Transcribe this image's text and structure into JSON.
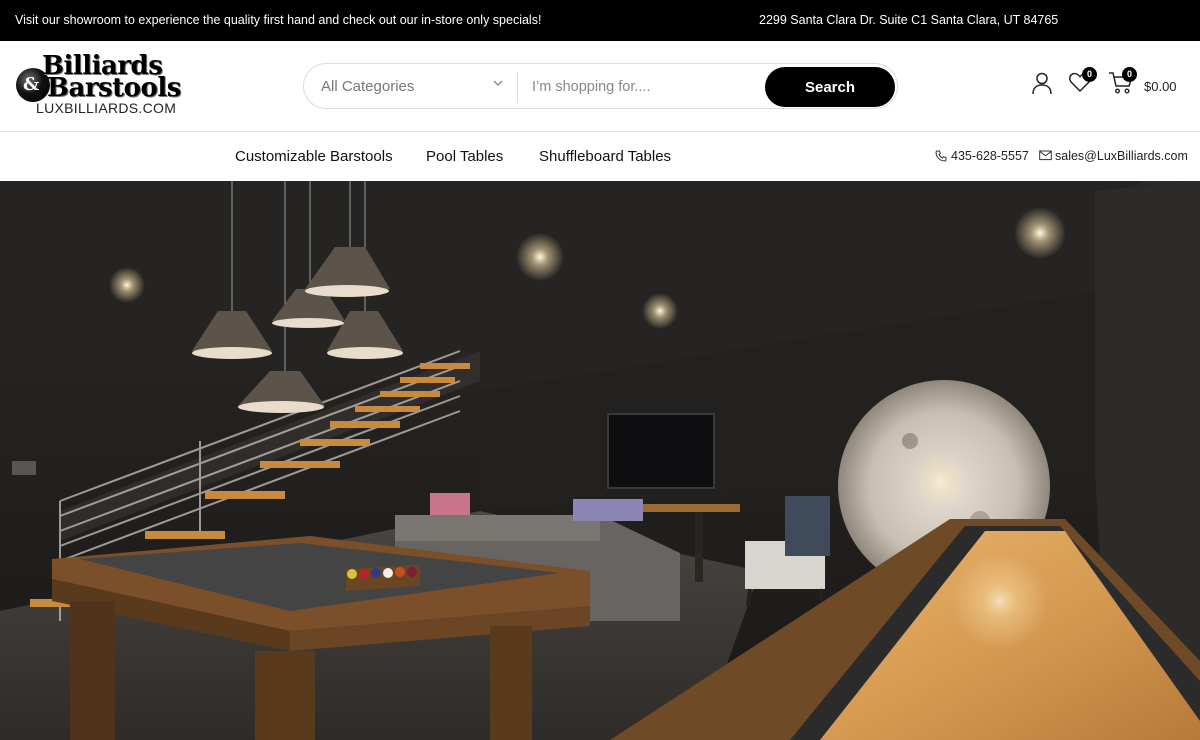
{
  "topbar": {
    "promo": "Visit our showroom to experience the quality first hand and check out our in-store only specials!",
    "address": "2299 Santa Clara Dr. Suite C1 Santa Clara, UT 84765"
  },
  "logo": {
    "line1": "Billiards",
    "line2": "Barstools",
    "ampersand": "&",
    "site": "LUXBILLIARDS.COM"
  },
  "search": {
    "category": "All Categories",
    "placeholder": "I’m shopping for....",
    "button": "Search"
  },
  "header_icons": {
    "wishlist_count": "0",
    "cart_count": "0",
    "cart_total": "$0.00"
  },
  "nav": {
    "items": [
      "Customizable Barstools",
      "Pool Tables",
      "Shuffleboard Tables"
    ],
    "phone": "435-628-5557",
    "email": "sales@LuxBilliards.com"
  },
  "colors": {
    "topbar_bg": "#000000",
    "button_bg": "#000000",
    "accent": "#c8873a"
  }
}
